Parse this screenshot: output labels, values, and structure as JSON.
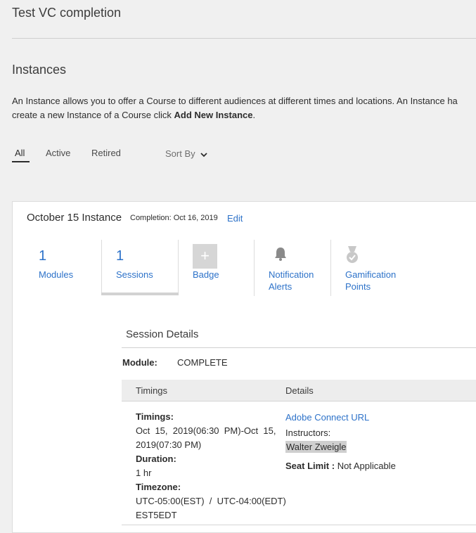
{
  "page": {
    "title": "Test VC completion"
  },
  "instances": {
    "title": "Instances",
    "description_part1": "An Instance allows you to offer a Course to different audiences at different times and locations. An Instance ha",
    "description_part2": "create a new Instance of a Course click ",
    "description_bold": "Add New Instance",
    "description_end": "."
  },
  "filters": {
    "tabs": [
      "All",
      "Active",
      "Retired"
    ],
    "active": "All",
    "sort_label": "Sort By"
  },
  "instance_card": {
    "name": "October 15 Instance",
    "completion": "Completion: Oct 16, 2019",
    "edit_label": "Edit",
    "stats": [
      {
        "count": "1",
        "label": "Modules"
      },
      {
        "count": "1",
        "label": "Sessions"
      },
      {
        "label": "Badge"
      },
      {
        "label_line1": "Notification",
        "label_line2": "Alerts"
      },
      {
        "label_line1": "Gamification",
        "label_line2": "Points"
      }
    ]
  },
  "session_details": {
    "title": "Session Details",
    "module_label": "Module:",
    "module_value": "COMPLETE",
    "columns": [
      "Timings",
      "Details"
    ],
    "timings_label": "Timings:",
    "timings_line1": "Oct  15,  2019(06:30  PM)-Oct  15,",
    "timings_line2": "2019(07:30 PM)",
    "duration_label": "Duration:",
    "duration_value": "1 hr",
    "timezone_label": "Timezone:",
    "timezone_line1": "UTC-05:00(EST)  /  UTC-04:00(EDT)",
    "timezone_line2": "EST5EDT",
    "connect_link": "Adobe Connect URL",
    "instructors_label": "Instructors:",
    "instructor_name": "Walter Zweigle",
    "seat_limit_label": "Seat Limit :",
    "seat_limit_value": " Not Applicable"
  },
  "colors": {
    "link": "#2d72c9",
    "background": "#f0f0f0"
  }
}
